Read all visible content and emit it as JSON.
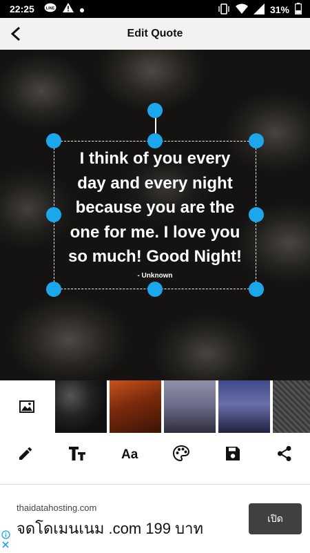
{
  "status_bar": {
    "time": "22:25",
    "battery": "31%"
  },
  "header": {
    "title": "Edit Quote"
  },
  "quote": {
    "lines": [
      "I think of you every",
      "day and every night",
      "because you are the",
      "one for me. I love you",
      "so much! Good Night!"
    ],
    "author": "- Unknown"
  },
  "toolbar": {
    "tools": [
      "pencil-icon",
      "text-size-icon",
      "font-icon",
      "palette-icon",
      "save-icon",
      "share-icon"
    ]
  },
  "ad": {
    "domain": "thaidatahosting.com",
    "headline": "จดโดเมนเนม .com 199 บาท",
    "button_label": "เปิด"
  },
  "colors": {
    "accent": "#1aa7ec",
    "appbar": "#f2f2f2",
    "ad_button": "#404040"
  }
}
